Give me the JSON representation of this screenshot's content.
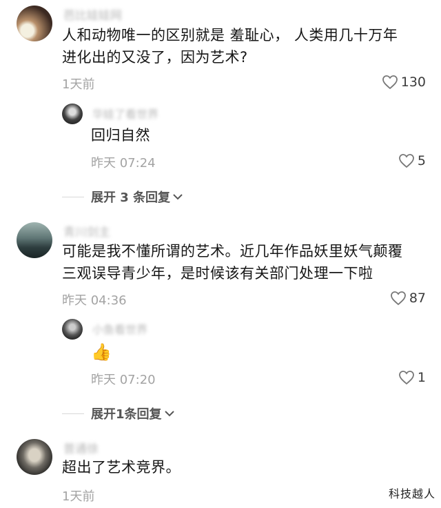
{
  "comments": [
    {
      "username": "芭比娃娃网",
      "text": "人和动物唯一的区别就是 羞耻心， 人类用几十万年\n进化出的又没了，因为艺术?",
      "time": "1天前",
      "likes": "130",
      "replies": [
        {
          "username": "华娃了看世界",
          "text": "回归自然",
          "time": "昨天 07:24",
          "likes": "5"
        }
      ],
      "expand_label": "展开 3 条回复"
    },
    {
      "username": "青川剑主",
      "text": "可能是我不懂所谓的艺术。近几年作品妖里妖气颠覆\n三观误导青少年，是时候该有关部门处理一下啦",
      "time": "昨天 04:36",
      "likes": "87",
      "replies": [
        {
          "username": "小鱼看世界",
          "text": "👍",
          "time": "昨天 07:20",
          "likes": "1"
        }
      ],
      "expand_label": "展开1条回复"
    },
    {
      "username": "普通徐",
      "text": "超出了艺术竞界。",
      "time": "1天前"
    }
  ],
  "watermark": "科技越人",
  "icons": {
    "like": "heart-outline-icon",
    "expand": "chevron-down-icon"
  }
}
